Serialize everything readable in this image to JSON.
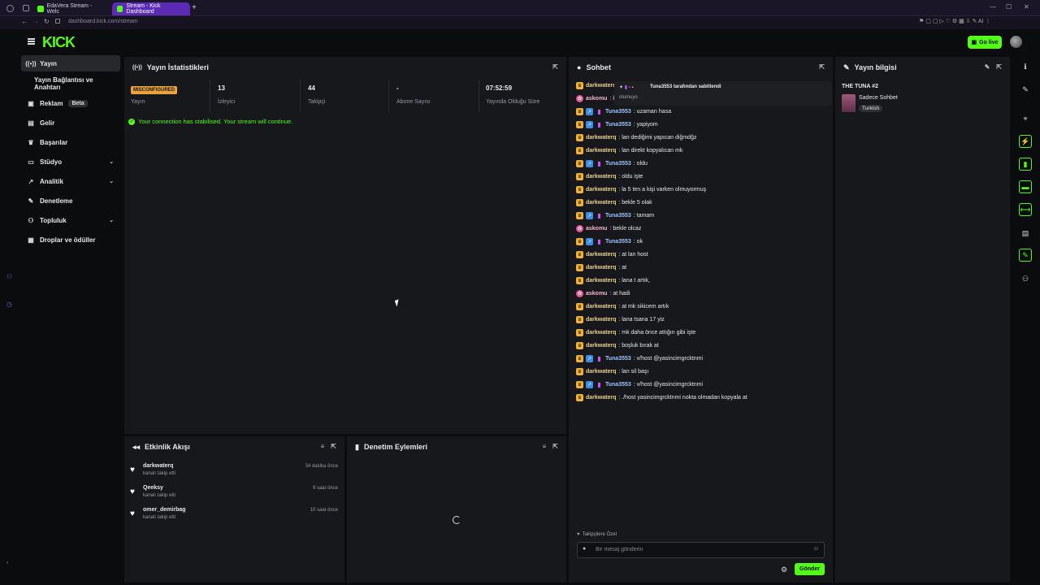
{
  "browser": {
    "tabs": [
      {
        "label": "EdaVera Stream - Welc"
      },
      {
        "label": "Stream - Kick Dashboard"
      }
    ],
    "url": "dashboard.kick.com/stream"
  },
  "header": {
    "logo": "KICK",
    "go_live": "Go live"
  },
  "sidebar": {
    "items": [
      {
        "label": "Yayın"
      },
      {
        "label": "Yayın Bağlantısı ve Anahtarı"
      },
      {
        "label": "Reklam",
        "badge": "Beta"
      },
      {
        "label": "Gelir"
      },
      {
        "label": "Başarılar"
      },
      {
        "label": "Stüdyo"
      },
      {
        "label": "Analitik"
      },
      {
        "label": "Denetleme"
      },
      {
        "label": "Topluluk"
      },
      {
        "label": "Droplar ve ödüller"
      }
    ]
  },
  "stats": {
    "title": "Yayın İstatistikleri",
    "badge": "MISCONFIGURED",
    "items": [
      {
        "value": "",
        "label": "Yayın"
      },
      {
        "value": "13",
        "label": "İzleyici"
      },
      {
        "value": "44",
        "label": "Takipçi"
      },
      {
        "value": "-",
        "label": "Abone Sayısı"
      },
      {
        "value": "07:52:59",
        "label": "Yayında Olduğu Süre"
      }
    ],
    "status_message": "Your connection has stabilised. Your stream will continue."
  },
  "activity": {
    "title": "Etkinlik Akışı",
    "items": [
      {
        "name": "darkwaterq",
        "sub": "kanalı takip etti",
        "time": "34 dakika önce"
      },
      {
        "name": "Qeeksy",
        "sub": "kanalı takip etti",
        "time": "9 saat önce"
      },
      {
        "name": "omer_demirbag",
        "sub": "kanalı takip etti",
        "time": "10 saat önce"
      }
    ]
  },
  "moderation": {
    "title": "Denetim Eylemleri"
  },
  "chat": {
    "title": "Sohbet",
    "pinned": {
      "by": "Tuna3553 tarafından sabitlendi",
      "text": "olumuyo"
    },
    "messages": [
      {
        "user": "darkwaterq",
        "kind": "dw",
        "text": ": k"
      },
      {
        "user": "askomu",
        "kind": "as",
        "text": ": k"
      },
      {
        "user": "Tuna3553",
        "kind": "tu",
        "text": ": uzamarı hasa"
      },
      {
        "user": "Tuna3553",
        "kind": "tu",
        "text": ": yapiyom"
      },
      {
        "user": "darkwaterq",
        "kind": "dw",
        "text": ": lan dediğimi yapıcan diğmdğz"
      },
      {
        "user": "darkwaterq",
        "kind": "dw",
        "text": ": lan direkt kopyalıcan mk"
      },
      {
        "user": "Tuna3553",
        "kind": "tu",
        "text": ": oldu"
      },
      {
        "user": "darkwaterq",
        "kind": "dw",
        "text": ": oldu işte"
      },
      {
        "user": "darkwaterq",
        "kind": "dw",
        "text": ": la 5 ten a kişi varken olmuyormuş"
      },
      {
        "user": "darkwaterq",
        "kind": "dw",
        "text": ": bekle 5 olak"
      },
      {
        "user": "Tuna3553",
        "kind": "tu",
        "text": ": tamam"
      },
      {
        "user": "askomu",
        "kind": "as",
        "text": ": bekle olcaz"
      },
      {
        "user": "Tuna3553",
        "kind": "tu",
        "text": ": ok"
      },
      {
        "user": "darkwaterq",
        "kind": "dw",
        "text": ": at lan host"
      },
      {
        "user": "darkwaterq",
        "kind": "dw",
        "text": ": at"
      },
      {
        "user": "darkwaterq",
        "kind": "dw",
        "text": ": lana t artık,"
      },
      {
        "user": "askomu",
        "kind": "as",
        "text": ": at hadi"
      },
      {
        "user": "darkwaterq",
        "kind": "dw",
        "text": ": at mk sikicem artık"
      },
      {
        "user": "darkwaterq",
        "kind": "dw",
        "text": ": lana tsana 17 yiz"
      },
      {
        "user": "darkwaterq",
        "kind": "dw",
        "text": ": mk daha önce attığın gibi işte"
      },
      {
        "user": "darkwaterq",
        "kind": "dw",
        "text": ": boşluk bırak at"
      },
      {
        "user": "Tuna3553",
        "kind": "tu",
        "text": ": v/host @yasincimgrcktnmi"
      },
      {
        "user": "darkwaterq",
        "kind": "dw",
        "text": ": lan sil başı"
      },
      {
        "user": "Tuna3553",
        "kind": "tu",
        "text": ": v/host @yasincimgrcktnmi"
      },
      {
        "user": "darkwaterq",
        "kind": "dw",
        "text": ": ./host yasincimgrcktnmi nokta olmadan kopyala at"
      }
    ],
    "followers_only": "Takipçilere Özel",
    "input_placeholder": "Bir mesaj gönderin",
    "send": "Gönder"
  },
  "stream_info": {
    "title": "Yayın bilgisi",
    "stream_title": "THE TUNA #2",
    "category": "Sadece Sohbet",
    "language": "Turkish"
  }
}
